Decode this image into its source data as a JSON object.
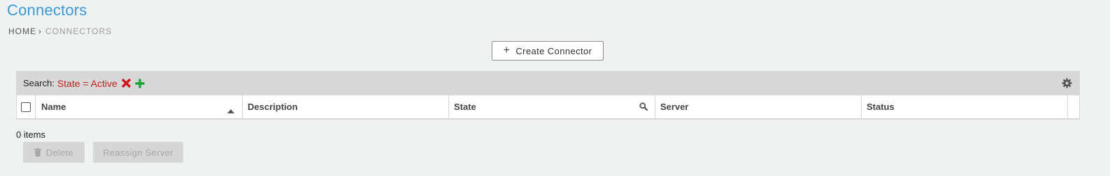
{
  "page": {
    "title": "Connectors"
  },
  "breadcrumb": {
    "home": "HOME",
    "separator": "›",
    "current": "CONNECTORS"
  },
  "toolbar": {
    "create_icon": "plus-icon",
    "create_label": "Create Connector"
  },
  "search": {
    "label": "Search:",
    "filter": "State = Active",
    "remove_icon": "close-icon",
    "add_icon": "plus-icon",
    "settings_icon": "gear-icon"
  },
  "table": {
    "columns": [
      "Name",
      "Description",
      "State",
      "Server",
      "Status"
    ],
    "sort_column": "Name",
    "sort_direction": "ascending",
    "rows": []
  },
  "footer": {
    "item_count": "0 items",
    "delete_label": "Delete",
    "reassign_label": "Reassign Server"
  },
  "colors": {
    "title": "#3c99d4",
    "filter_text": "#c0211b",
    "remove": "#d0141a",
    "add": "#1aa33c",
    "disabled_button": "#d6d6d6"
  }
}
